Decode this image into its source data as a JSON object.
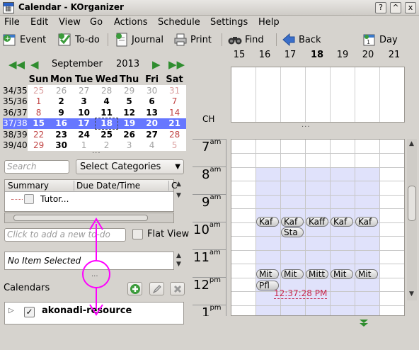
{
  "window": {
    "title": "Calendar - KOrganizer",
    "buttons": [
      "?",
      "^",
      "x"
    ]
  },
  "menu": [
    "File",
    "Edit",
    "View",
    "Go",
    "Actions",
    "Schedule",
    "Settings",
    "Help"
  ],
  "toolbar": {
    "event": "Event",
    "todo": "To-do",
    "journal": "Journal",
    "print": "Print",
    "find": "Find",
    "back": "Back",
    "day": "Day"
  },
  "mini_calendar": {
    "month": "September",
    "year": "2013",
    "weekday_headers": [
      "Sun",
      "Mon",
      "Tue",
      "Wed",
      "Thu",
      "Fri",
      "Sat"
    ],
    "weeks": [
      {
        "week": "34/35",
        "days": [
          "25",
          "26",
          "27",
          "28",
          "29",
          "30",
          "31"
        ]
      },
      {
        "week": "35/36",
        "days": [
          "1",
          "2",
          "3",
          "4",
          "5",
          "6",
          "7"
        ]
      },
      {
        "week": "36/37",
        "days": [
          "8",
          "9",
          "10",
          "11",
          "12",
          "13",
          "14"
        ]
      },
      {
        "week": "37/38",
        "days": [
          "15",
          "16",
          "17",
          "18",
          "19",
          "20",
          "21"
        ]
      },
      {
        "week": "38/39",
        "days": [
          "22",
          "23",
          "24",
          "25",
          "26",
          "27",
          "28"
        ]
      },
      {
        "week": "39/40",
        "days": [
          "29",
          "30",
          "1",
          "2",
          "3",
          "4",
          "5"
        ]
      }
    ],
    "more": "..."
  },
  "search": {
    "placeholder": "Search",
    "categories": "Select Categories"
  },
  "todo_list": {
    "columns": [
      "Summary",
      "Due Date/Time",
      "C"
    ],
    "rows": [
      {
        "summary": "Tutor..."
      }
    ],
    "new_placeholder": "Click to add a new to-do",
    "flat_view": "Flat View"
  },
  "item_viewer": {
    "text": "No Item Selected"
  },
  "calendars": {
    "label": "Calendars",
    "items": [
      {
        "name": "akonadi-resource",
        "checked": true
      }
    ]
  },
  "agenda": {
    "day_headers": [
      "15",
      "16",
      "17",
      "18",
      "19",
      "20",
      "21"
    ],
    "today_day": "18",
    "timezone": "CH",
    "hours": [
      {
        "h": "7",
        "ampm": "am"
      },
      {
        "h": "8",
        "ampm": "am"
      },
      {
        "h": "9",
        "ampm": "am"
      },
      {
        "h": "10",
        "ampm": "am"
      },
      {
        "h": "11",
        "ampm": "am"
      },
      {
        "h": "12",
        "ampm": "pm"
      },
      {
        "h": "1",
        "ampm": "pm"
      }
    ],
    "events_row1": [
      "Kaf",
      "Kaf",
      "Kaff",
      "Kaf",
      "Kaf"
    ],
    "events_row2": [
      "Sta"
    ],
    "events_row3": [
      "Mit",
      "Mit",
      "Mitt",
      "Mit",
      "Mit"
    ],
    "events_row4": [
      "Pfl"
    ],
    "current_time": "12:37:28 PM",
    "more": "..."
  },
  "colors": {
    "accent_green": "#2f8d2f",
    "selection": "#6677ff",
    "work_hours": "#e0e2fb",
    "annotation": "#ff00ff",
    "now_marker": "#c8284e"
  }
}
